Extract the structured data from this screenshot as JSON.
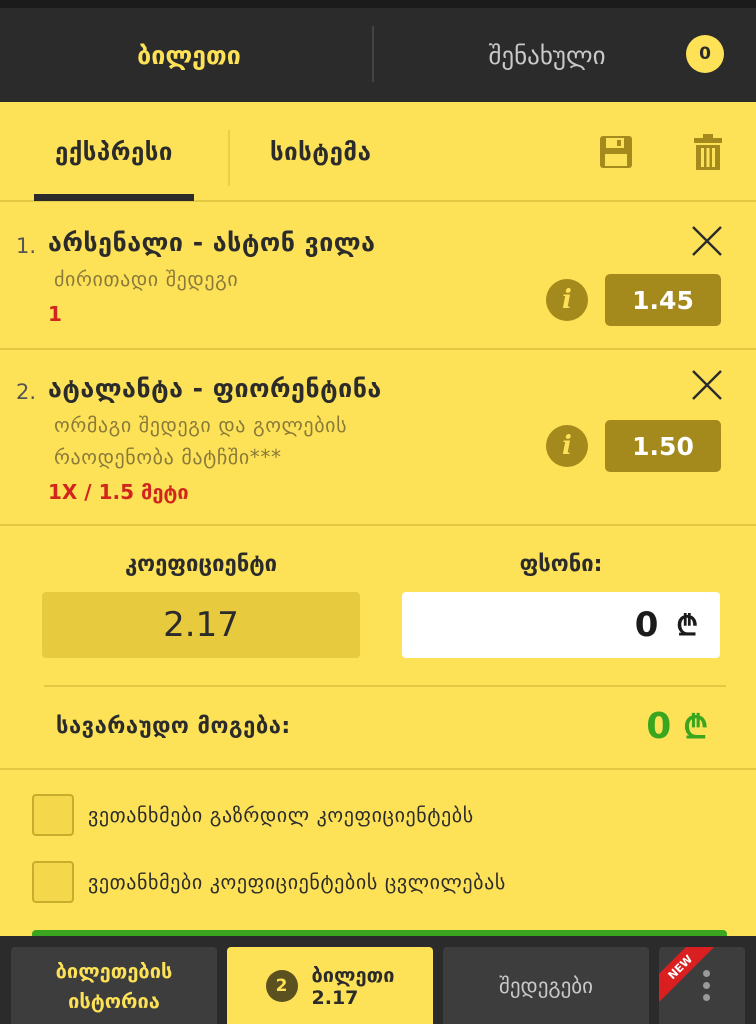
{
  "topbar": {
    "tab_ticket": "ბილეთი",
    "tab_saved": "შენახული",
    "saved_count": "0"
  },
  "subtabs": {
    "express": "ექსპრესი",
    "system": "სისტემა",
    "icons": {
      "save": "save-icon",
      "delete": "trash-icon"
    }
  },
  "bets": [
    {
      "number": "1.",
      "title": "არსენალი - ასტონ ვილა",
      "market": "ძირითადი შედეგი",
      "pick": "1",
      "odd": "1.45"
    },
    {
      "number": "2.",
      "title": "ატალანტა - ფიორენტინა",
      "market_line1": "ორმაგი შედეგი და გოლების",
      "market_line2": "რაოდენობა მატჩში***",
      "pick": "1X / 1.5 მეტი",
      "odd": "1.50"
    }
  ],
  "summary": {
    "coef_label": "კოეფიციენტი",
    "coef_value": "2.17",
    "stake_label": "ფსონი:",
    "stake_value": "0",
    "currency": "₾",
    "win_label": "სავარაუდო მოგება:",
    "win_value": "0"
  },
  "options": [
    {
      "label": "ვეთანხმები გაზრდილ კოეფიციენტებს"
    },
    {
      "label": "ვეთანხმები კოეფიციენტების ცვლილებას"
    }
  ],
  "bottom_nav": {
    "history_line1": "ბილეთების",
    "history_line2": "ისტორია",
    "ticket_count": "2",
    "ticket_label": "ბილეთი",
    "ticket_odds": "2.17",
    "results": "შედეგები",
    "new_badge": "NEW"
  },
  "colors": {
    "accent": "#fde257",
    "dark": "#2b2b2b",
    "odd_button": "#a4891c",
    "pick_red": "#d0261d",
    "win_green": "#3aa51e"
  }
}
